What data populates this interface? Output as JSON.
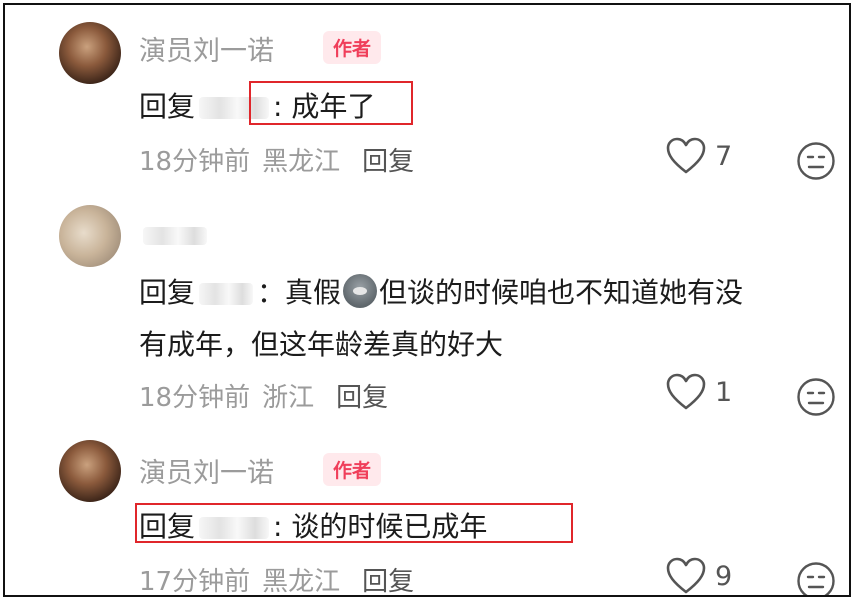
{
  "comments": [
    {
      "username": "演员刘一诺",
      "badge": "作者",
      "reply_prefix": "回复",
      "text": ": 成年了",
      "time": "18分钟前",
      "location": "黑龙江",
      "reply_label": "回复",
      "likes": "7"
    },
    {
      "username": "",
      "badge": "",
      "reply_prefix": "回复",
      "text_part1": "：真假",
      "text_part2": "但谈的时候咱也不知道她有没",
      "text_line2": "有成年，但这年龄差真的好大",
      "time": "18分钟前",
      "location": "浙江",
      "reply_label": "回复",
      "likes": "1"
    },
    {
      "username": "演员刘一诺",
      "badge": "作者",
      "reply_prefix": "回复",
      "text": ": 谈的时候已成年",
      "time": "17分钟前",
      "location": "黑龙江",
      "reply_label": "回复",
      "likes": "9"
    }
  ],
  "icons": {
    "like": "heart-outline-icon",
    "dislike": "neutral-face-icon"
  },
  "colors": {
    "badge_text": "#f03e5a",
    "badge_bg": "#ffe9ec",
    "highlight_box": "#e0262b",
    "muted_text": "#9b9b9b"
  }
}
